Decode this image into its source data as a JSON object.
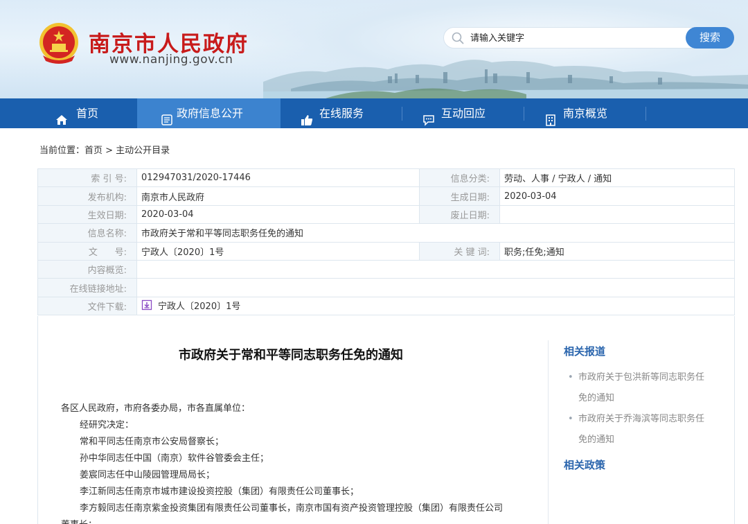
{
  "header": {
    "site_title": "南京市人民政府",
    "site_url": "www.nanjing.gov.cn",
    "search_placeholder": "请输入关键字",
    "search_button": "搜索"
  },
  "nav": {
    "items": [
      {
        "label": "首页",
        "icon": "home-icon"
      },
      {
        "label": "政府信息公开",
        "icon": "document-icon",
        "active": true
      },
      {
        "label": "在线服务",
        "icon": "thumbs-up-icon"
      },
      {
        "label": "互动回应",
        "icon": "chat-icon"
      },
      {
        "label": "南京概览",
        "icon": "building-icon"
      }
    ]
  },
  "breadcrumb": "当前位置：首页 > 主动公开目录",
  "meta": {
    "index_label": "索 引 号:",
    "index_value": "012947031/2020-17446",
    "category_label": "信息分类:",
    "category_value": "劳动、人事 / 宁政人 / 通知",
    "issuer_label": "发布机构:",
    "issuer_value": "南京市人民政府",
    "created_label": "生成日期:",
    "created_value": "2020-03-04",
    "effective_label": "生效日期:",
    "effective_value": "2020-03-04",
    "abolished_label": "废止日期:",
    "abolished_value": "",
    "name_label": "信息名称:",
    "name_value": "市政府关于常和平等同志职务任免的通知",
    "docno_label": "文      号:",
    "docno_value": "宁政人〔2020〕1号",
    "keywords_label": "关 键 词:",
    "keywords_value": "职务;任免;通知",
    "summary_label": "内容概览:",
    "summary_value": "",
    "link_label": "在线链接地址:",
    "link_value": "",
    "download_label": "文件下载:",
    "download_value": "宁政人〔2020〕1号"
  },
  "document": {
    "title": "市政府关于常和平等同志职务任免的通知",
    "lines": [
      "各区人民政府，市府各委办局，市各直属单位：",
      "经研究决定：",
      "常和平同志任南京市公安局督察长；",
      "孙中华同志任中国（南京）软件谷管委会主任；",
      "姜宸同志任中山陵园管理局局长；",
      "李江新同志任南京市城市建设投资控股（集团）有限责任公司董事长；",
      "李方毅同志任南京紫金投资集团有限责任公司董事长，南京市国有资产投资管理控股（集团）有限责任公司",
      "董事长；"
    ]
  },
  "sidebar": {
    "related_news_title": "相关报道",
    "related_news": [
      {
        "line1": "市政府关于包洪新等同志职务任",
        "line2": "免的通知"
      },
      {
        "line1": "市政府关于乔海滨等同志职务任",
        "line2": "免的通知"
      }
    ],
    "related_policy_title": "相关政策"
  },
  "colors": {
    "nav_bg": "#1a5fae",
    "nav_active": "#3c83cf",
    "title_red": "#c81b1b",
    "accent_blue": "#2a65ad",
    "search_button": "#3f86d4"
  }
}
